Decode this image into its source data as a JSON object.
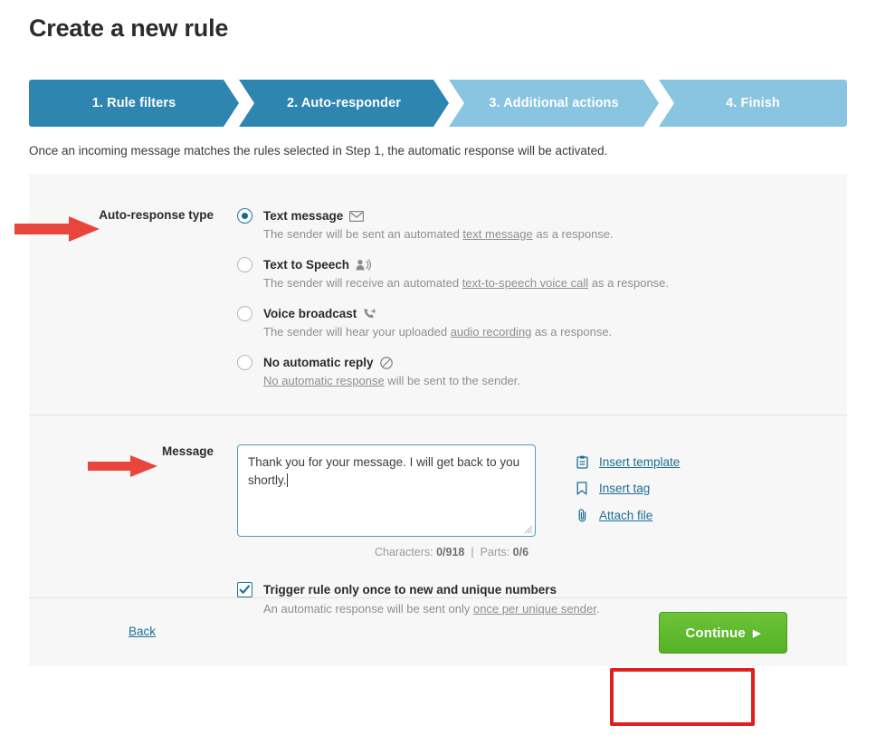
{
  "page": {
    "title": "Create a new rule",
    "intro": "Once an incoming message matches the rules selected in Step 1, the automatic response will be activated."
  },
  "wizard": {
    "steps": [
      {
        "label": "1. Rule filters",
        "state": "active"
      },
      {
        "label": "2. Auto-responder",
        "state": "active"
      },
      {
        "label": "3. Additional actions",
        "state": "inactive"
      },
      {
        "label": "4. Finish",
        "state": "inactive"
      }
    ],
    "active_color": "#2e86b0",
    "inactive_color": "#89c4e0"
  },
  "auto_response": {
    "label": "Auto-response type",
    "options": [
      {
        "title": "Text message",
        "icon": "envelope-icon",
        "selected": true,
        "desc_before": "The sender will be sent an automated ",
        "desc_link": "text message",
        "desc_after": " as a response."
      },
      {
        "title": "Text to Speech",
        "icon": "person-speaking-icon",
        "selected": false,
        "desc_before": "The sender will receive an automated ",
        "desc_link": "text-to-speech voice call",
        "desc_after": " as a response."
      },
      {
        "title": "Voice broadcast",
        "icon": "phone-broadcast-icon",
        "selected": false,
        "desc_before": "The sender will hear your uploaded ",
        "desc_link": "audio recording",
        "desc_after": " as a response."
      },
      {
        "title": "No automatic reply",
        "icon": "no-entry-icon",
        "selected": false,
        "desc_before": "",
        "desc_link": "No automatic response",
        "desc_after": " will be sent to the sender."
      }
    ]
  },
  "message": {
    "label": "Message",
    "value": "Thank you for your message. I will get back to you shortly.",
    "placeholder": "",
    "links": [
      {
        "label": "Insert template",
        "icon": "clipboard-icon"
      },
      {
        "label": "Insert tag",
        "icon": "bookmark-icon"
      },
      {
        "label": "Attach file",
        "icon": "paperclip-icon"
      }
    ],
    "counter": {
      "characters_label": "Characters:",
      "characters_value": "0/918",
      "separator": "|",
      "parts_label": "Parts:",
      "parts_value": "0/6"
    }
  },
  "trigger_once": {
    "checked": true,
    "title": "Trigger rule only once to new and unique numbers",
    "desc_before": "An automatic response will be sent only ",
    "desc_link": "once per unique sender",
    "desc_after": "."
  },
  "footer": {
    "back_label": "Back",
    "continue_label": "Continue",
    "continue_arrow": "▶",
    "continue_color": "#5cb82b"
  },
  "annotations": {
    "arrow_color": "#e8463c",
    "highlight_color": "#e02020",
    "arrow_1_target": "Auto-response type",
    "arrow_2_target": "Message",
    "highlight_target": "Continue"
  }
}
